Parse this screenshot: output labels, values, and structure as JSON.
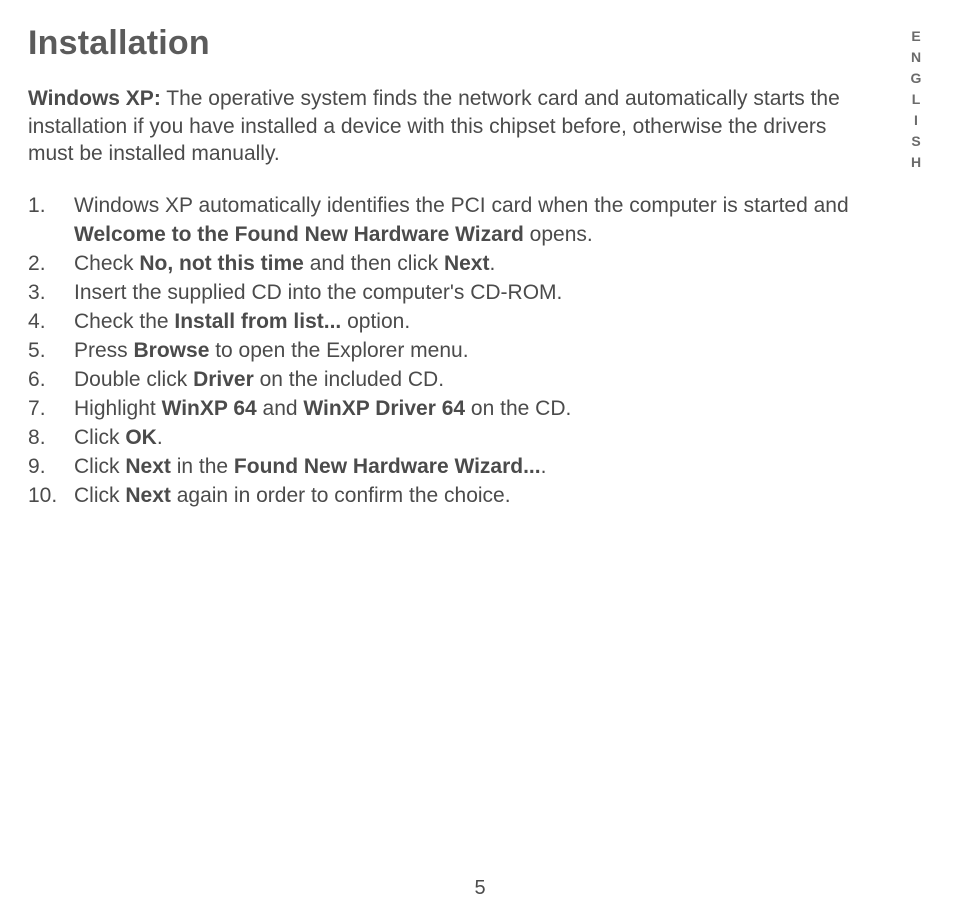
{
  "heading": "Installation",
  "intro_prefix": "Windows XP:",
  "intro_rest": " The operative system finds the network card and automatically starts the installation if you have installed a device with this chipset before, otherwise the drivers must be installed manually.",
  "side_label": "ENGLISH",
  "page_number": "5",
  "steps": [
    {
      "pre": "Windows XP automatically identifies the PCI card when the computer is started and ",
      "bold": "Welcome to the Found New Hardware Wizard",
      "post": " opens."
    },
    {
      "pre": "Check ",
      "bold": "No, not this time",
      "post": " and then click ",
      "bold2": "Next",
      "post2": "."
    },
    {
      "pre": "Insert the supplied CD into the computer's CD-ROM.",
      "bold": "",
      "post": ""
    },
    {
      "pre": "Check the ",
      "bold": "Install from list...",
      "post": " option."
    },
    {
      "pre": "Press ",
      "bold": "Browse",
      "post": " to open the Explorer menu."
    },
    {
      "pre": "Double click ",
      "bold": "Driver",
      "post": " on the included CD."
    },
    {
      "pre": "Highlight ",
      "bold": "WinXP 64",
      "post": " and ",
      "bold2": "WinXP Driver 64",
      "post2": " on the CD."
    },
    {
      "pre": "Click ",
      "bold": "OK",
      "post": "."
    },
    {
      "pre": "Click ",
      "bold": "Next",
      "post": " in the ",
      "bold2": "Found New Hardware Wizard...",
      "post2": "."
    },
    {
      "pre": "Click ",
      "bold": "Next",
      "post": " again in order to confirm the choice."
    }
  ]
}
